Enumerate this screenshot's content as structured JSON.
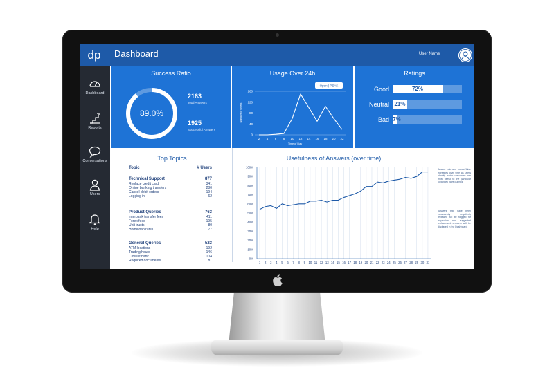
{
  "header": {
    "logo": "dp",
    "title": "Dashboard",
    "username": "User Name"
  },
  "sidebar": {
    "items": [
      {
        "label": "Dashboard",
        "icon": "speedometer-icon"
      },
      {
        "label": "Reports",
        "icon": "stairs-chart-icon"
      },
      {
        "label": "Conversations",
        "icon": "chat-bubble-icon"
      },
      {
        "label": "Users",
        "icon": "user-icon"
      },
      {
        "label": "Help",
        "icon": "bell-icon"
      }
    ]
  },
  "success": {
    "title": "Success Ratio",
    "percent_label": "89.0%",
    "ratio": 0.89,
    "total_value": "2163",
    "total_label": "Total Answers",
    "successful_value": "1925",
    "successful_label": "Successful Answers"
  },
  "usage": {
    "title": "Usage Over 24h",
    "legend": "Open | PEAK",
    "ylabel": "Number of Users",
    "xlabel": "Time of Day"
  },
  "ratings": {
    "title": "Ratings",
    "items": [
      {
        "label": "Good",
        "value_label": "72%",
        "value": 0.72
      },
      {
        "label": "Neutral",
        "value_label": "21%",
        "value": 0.21
      },
      {
        "label": "Bad",
        "value_label": "7%",
        "value": 0.07
      }
    ]
  },
  "topics": {
    "title": "Top Topics",
    "col_topic": "Topic",
    "col_users": "# Users",
    "groups": [
      {
        "name": "Technical Support",
        "total": "877",
        "rows": [
          [
            "Replace credit card",
            "341"
          ],
          [
            "Online banking transfers",
            "280"
          ],
          [
            "Cancel debit orders",
            "194"
          ],
          [
            "Logging in",
            "62"
          ],
          [
            "...",
            ""
          ]
        ]
      },
      {
        "name": "Product Queries",
        "total": "763",
        "rows": [
          [
            "Interbank transfer fees",
            "411"
          ],
          [
            "Forex fees",
            "195"
          ],
          [
            "Unit trusts",
            "80"
          ],
          [
            "Homeloan rates",
            "77"
          ],
          [
            "...",
            ""
          ]
        ]
      },
      {
        "name": "General Queries",
        "total": "523",
        "rows": [
          [
            "ATM locations",
            "192"
          ],
          [
            "Trading hours",
            "146"
          ],
          [
            "Closest bank",
            "104"
          ],
          [
            "Required documents",
            "81"
          ]
        ]
      }
    ]
  },
  "usefulness": {
    "title": "Usefulness of Answers (over time)",
    "note1": "Answer rate and correct/false increases over time as users identify which responses are most useful to the particular topic they have queried.",
    "note2": "Answers that have been consistently negatively reviewed will be flagged for inspection and suggested replacement answers will be displayed in the Dashboard."
  },
  "chart_data": [
    {
      "type": "line",
      "title": "Usage Over 24h",
      "xlabel": "Time of Day",
      "ylabel": "Number of Users",
      "x": [
        2,
        4,
        6,
        8,
        10,
        12,
        14,
        16,
        18,
        20,
        22
      ],
      "values": [
        0,
        0,
        2,
        5,
        60,
        150,
        100,
        50,
        105,
        60,
        20
      ],
      "xticks": [
        "2",
        "4",
        "6",
        "8",
        "10",
        "12",
        "14",
        "16",
        "18",
        "20",
        "22"
      ],
      "yticks": [
        "0",
        "40",
        "80",
        "120",
        "160"
      ],
      "ylim": [
        0,
        160
      ],
      "grid": true
    },
    {
      "type": "line",
      "title": "Usefulness of Answers (over time)",
      "x": [
        1,
        2,
        3,
        4,
        5,
        6,
        7,
        8,
        9,
        10,
        11,
        12,
        13,
        14,
        15,
        16,
        17,
        18,
        19,
        20,
        21,
        22,
        23,
        24,
        25,
        26,
        27,
        28,
        29,
        30,
        31
      ],
      "values": [
        54,
        57,
        58,
        55,
        60,
        58,
        59,
        60,
        60,
        63,
        63,
        64,
        62,
        64,
        64,
        67,
        69,
        71,
        74,
        79,
        79,
        84,
        83,
        85,
        86,
        87,
        89,
        88,
        90,
        95,
        95
      ],
      "xticks": [
        "1",
        "2",
        "3",
        "4",
        "5",
        "6",
        "7",
        "8",
        "9",
        "10",
        "11",
        "12",
        "13",
        "14",
        "15",
        "16",
        "17",
        "18",
        "19",
        "20",
        "21",
        "22",
        "23",
        "24",
        "25",
        "26",
        "27",
        "28",
        "29",
        "30",
        "31"
      ],
      "yticks": [
        "0%",
        "10%",
        "20%",
        "30%",
        "40%",
        "50%",
        "60%",
        "70%",
        "80%",
        "90%",
        "100%"
      ],
      "ylim": [
        0,
        100
      ],
      "grid": true
    }
  ],
  "colors": {
    "primary": "#1e73d6",
    "dark": "#1e5aa8",
    "sidebar": "#252a33"
  }
}
